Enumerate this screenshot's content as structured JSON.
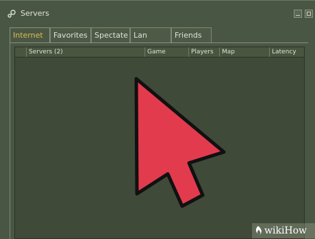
{
  "window": {
    "title": "Servers",
    "icon": "steam-icon"
  },
  "tabs": [
    {
      "label": "Internet",
      "active": true
    },
    {
      "label": "Favorites",
      "active": false
    },
    {
      "label": "Spectate",
      "active": false
    },
    {
      "label": "Lan",
      "active": false
    },
    {
      "label": "Friends",
      "active": false
    }
  ],
  "columns": [
    "Servers (2)",
    "Game",
    "Players",
    "Map",
    "Latency"
  ],
  "colors": {
    "active_tab_text": "#d8bf55",
    "pointer_arrow": "#e33b4e"
  },
  "watermark": {
    "text": "wikiHow"
  }
}
